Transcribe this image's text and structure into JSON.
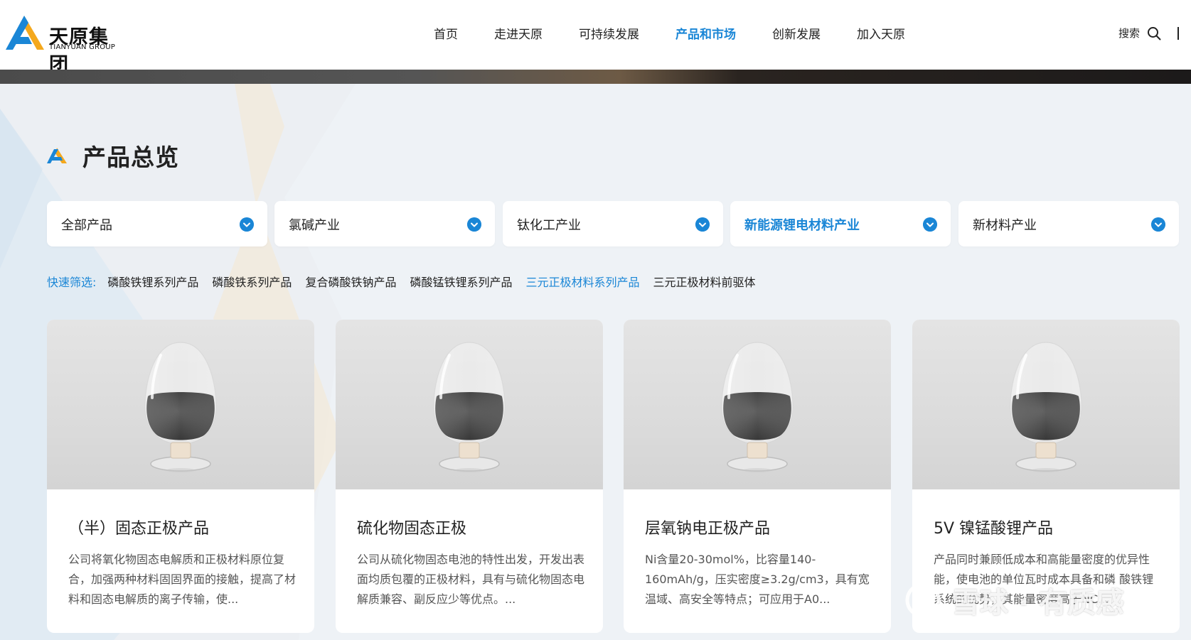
{
  "brand": {
    "name_cn": "天原集团",
    "name_en": "TIANYUAN GROUP"
  },
  "nav": {
    "items": [
      {
        "label": "首页"
      },
      {
        "label": "走进天原"
      },
      {
        "label": "可持续发展"
      },
      {
        "label": "产品和市场",
        "active": true
      },
      {
        "label": "创新发展"
      },
      {
        "label": "加入天原"
      }
    ],
    "search_label": "搜索",
    "accent": "#1a86d6"
  },
  "section": {
    "title": "产品总览"
  },
  "categories": [
    {
      "label": "全部产品"
    },
    {
      "label": "氯碱产业"
    },
    {
      "label": "钛化工产业"
    },
    {
      "label": "新能源锂电材料产业",
      "active": true
    },
    {
      "label": "新材料产业"
    }
  ],
  "quick_filter": {
    "label": "快速筛选:",
    "items": [
      {
        "label": "磷酸铁锂系列产品"
      },
      {
        "label": "磷酸铁系列产品"
      },
      {
        "label": "复合磷酸铁钠产品"
      },
      {
        "label": "磷酸锰铁锂系列产品"
      },
      {
        "label": "三元正极材料系列产品",
        "active": true
      },
      {
        "label": "三元正极材料前驱体"
      }
    ]
  },
  "products": [
    {
      "title": "（半）固态正极产品",
      "desc": "公司将氧化物固态电解质和正极材料原位复合，加强两种材料固固界面的接触，提高了材料和固态电解质的离子传输，使..."
    },
    {
      "title": "硫化物固态正极",
      "desc": "公司从硫化物固态电池的特性出发，开发出表面均质包覆的正极材料，具有与硫化物固态电解质兼容、副反应少等优点。..."
    },
    {
      "title": "层氧钠电正极产品",
      "desc": "Ni含量20-30mol%，比容量140-160mAh/g，压实密度≥3.2g/cm3，具有宽温域、高安全等特点；可应用于A0..."
    },
    {
      "title": "5V 镍锰酸锂产品",
      "desc": "产品同时兼顾低成本和高能量密度的优异性能，使电池的单位瓦时成本具备和磷 酸铁锂系统的优势，其能量密度高于NC..."
    }
  ],
  "watermark": {
    "text": "雪球 · 有质感"
  }
}
